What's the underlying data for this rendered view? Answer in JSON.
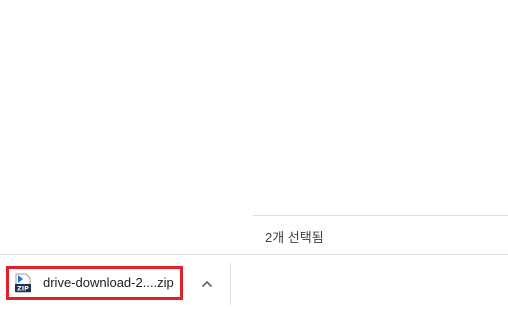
{
  "status": {
    "selection_text": "2개 선택됨"
  },
  "download_shelf": {
    "items": [
      {
        "file_name": "drive-download-2....zip",
        "icon": "zip-file-icon",
        "icon_label": "ZIP"
      }
    ],
    "expand_icon": "chevron-up-icon"
  },
  "colors": {
    "highlight_border": "#e0202a",
    "zip_icon_blue": "#1a73e8",
    "zip_icon_dark": "#1f2f56"
  }
}
